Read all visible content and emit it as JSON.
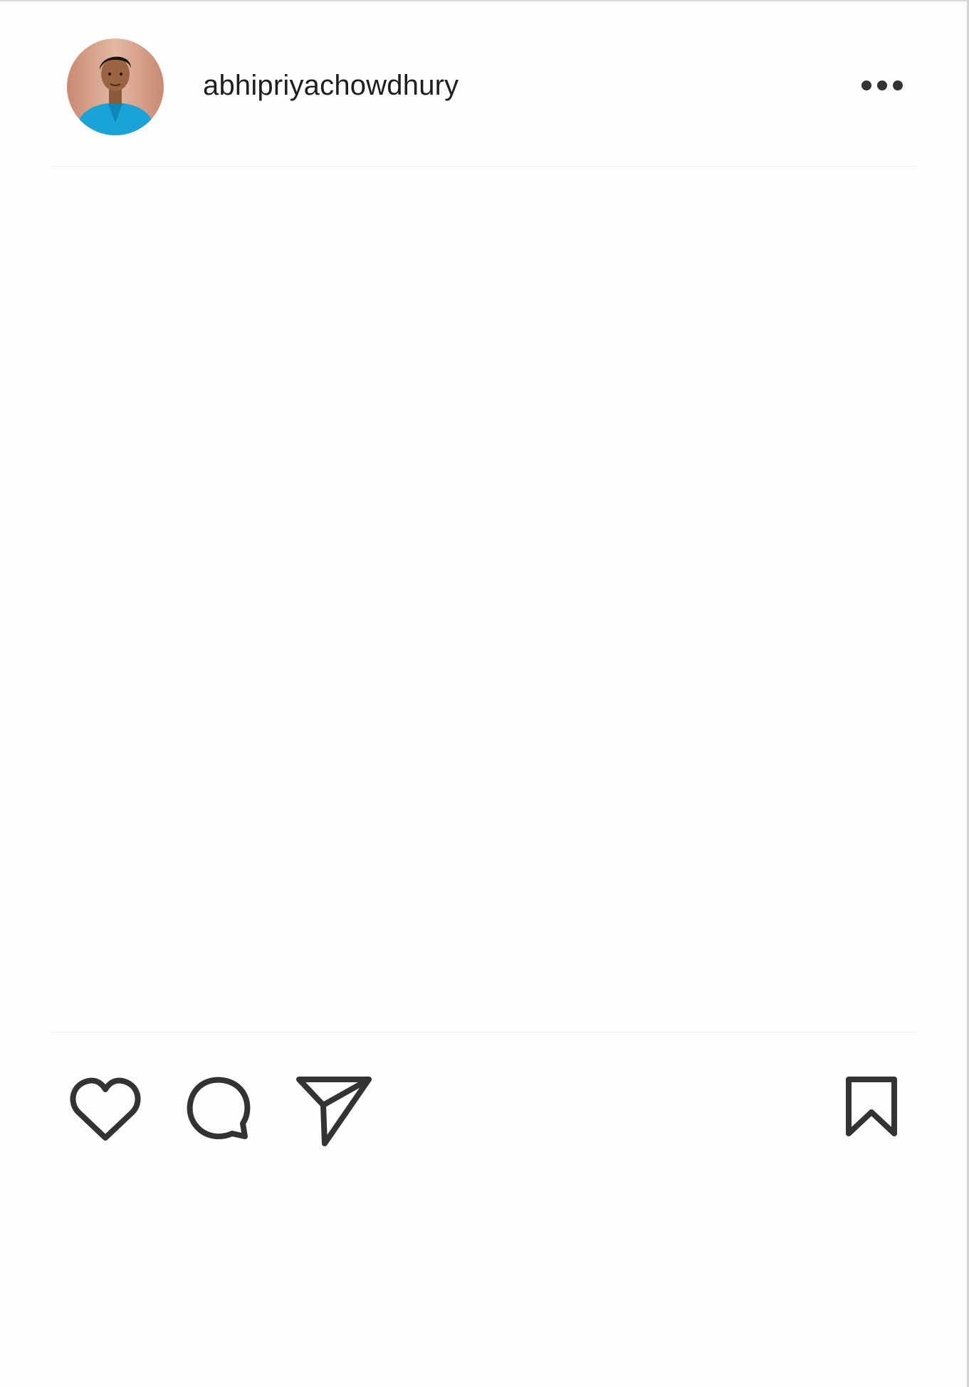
{
  "post": {
    "username": "abhipriyachowdhury",
    "avatar_alt": "profile photo",
    "more_icon": "more-horizontal-icon"
  },
  "actions": {
    "like_icon": "heart-icon",
    "comment_icon": "comment-bubble-icon",
    "share_icon": "paper-plane-icon",
    "save_icon": "bookmark-icon"
  },
  "colors": {
    "icon_stroke": "#333333",
    "text": "#1f1f1f",
    "background": "#fdfdfd"
  }
}
